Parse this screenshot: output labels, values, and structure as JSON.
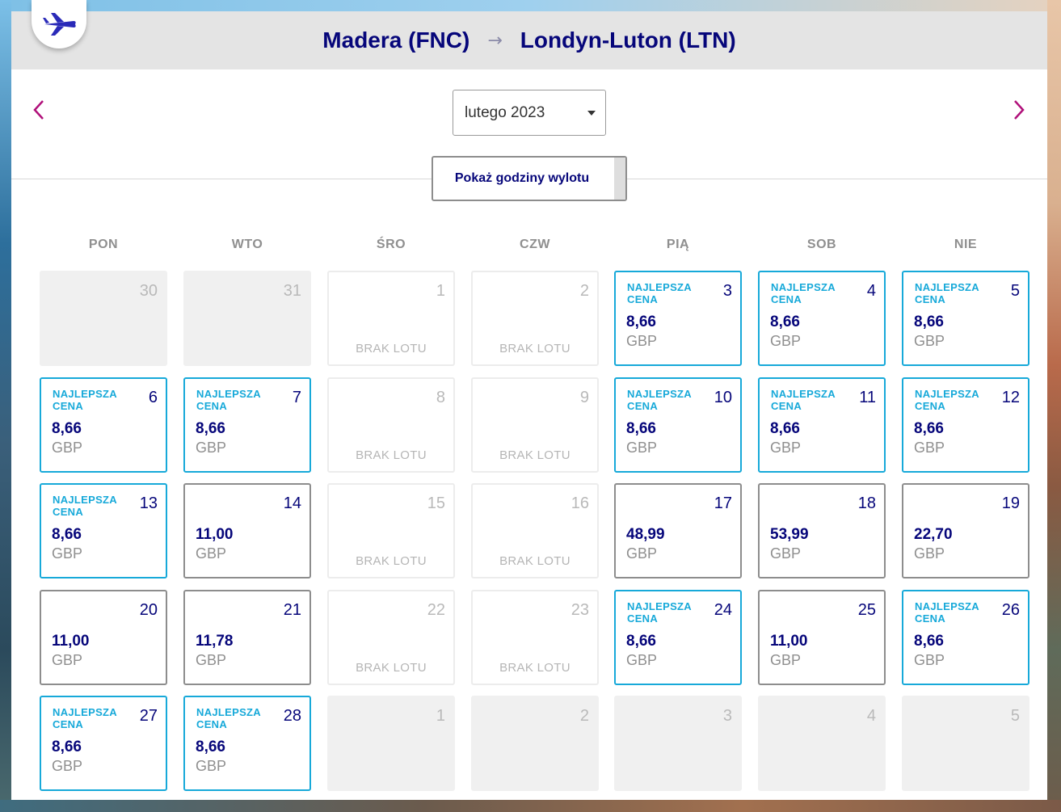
{
  "route": {
    "origin": "Madera (FNC)",
    "arrow": "→",
    "destination": "Londyn-Luton (LTN)"
  },
  "icons": {
    "plane": "airplane-icon",
    "prev": "chevron-left-icon",
    "next": "chevron-right-icon",
    "dropdown": "caret-down-icon"
  },
  "colors": {
    "brand_navy": "#06067a",
    "best_price_blue": "#17a9d9",
    "nav_magenta": "#b0107a",
    "header_gray": "#e4e4e4"
  },
  "month_selector": {
    "value": "lutego 2023"
  },
  "show_hours_button": {
    "label": "Pokaż godziny wylotu"
  },
  "weekdays": [
    "PON",
    "WTO",
    "ŚRO",
    "CZW",
    "PIĄ",
    "SOB",
    "NIE"
  ],
  "calendar": [
    [
      {
        "day": "30",
        "kind": "outside"
      },
      {
        "day": "31",
        "kind": "outside"
      },
      {
        "day": "1",
        "kind": "noflight",
        "label": "BRAK LOTU"
      },
      {
        "day": "2",
        "kind": "noflight",
        "label": "BRAK LOTU"
      },
      {
        "day": "3",
        "kind": "best",
        "badge": "NAJLEPSZA CENA",
        "price": "8,66",
        "currency": "GBP"
      },
      {
        "day": "4",
        "kind": "best",
        "badge": "NAJLEPSZA CENA",
        "price": "8,66",
        "currency": "GBP"
      },
      {
        "day": "5",
        "kind": "best",
        "badge": "NAJLEPSZA CENA",
        "price": "8,66",
        "currency": "GBP"
      }
    ],
    [
      {
        "day": "6",
        "kind": "best",
        "badge": "NAJLEPSZA CENA",
        "price": "8,66",
        "currency": "GBP"
      },
      {
        "day": "7",
        "kind": "best",
        "badge": "NAJLEPSZA CENA",
        "price": "8,66",
        "currency": "GBP"
      },
      {
        "day": "8",
        "kind": "noflight",
        "label": "BRAK LOTU"
      },
      {
        "day": "9",
        "kind": "noflight",
        "label": "BRAK LOTU"
      },
      {
        "day": "10",
        "kind": "best",
        "badge": "NAJLEPSZA CENA",
        "price": "8,66",
        "currency": "GBP"
      },
      {
        "day": "11",
        "kind": "best",
        "badge": "NAJLEPSZA CENA",
        "price": "8,66",
        "currency": "GBP"
      },
      {
        "day": "12",
        "kind": "best",
        "badge": "NAJLEPSZA CENA",
        "price": "8,66",
        "currency": "GBP"
      }
    ],
    [
      {
        "day": "13",
        "kind": "best",
        "badge": "NAJLEPSZA CENA",
        "price": "8,66",
        "currency": "GBP"
      },
      {
        "day": "14",
        "kind": "normal",
        "price": "11,00",
        "currency": "GBP"
      },
      {
        "day": "15",
        "kind": "noflight",
        "label": "BRAK LOTU"
      },
      {
        "day": "16",
        "kind": "noflight",
        "label": "BRAK LOTU"
      },
      {
        "day": "17",
        "kind": "normal",
        "price": "48,99",
        "currency": "GBP"
      },
      {
        "day": "18",
        "kind": "normal",
        "price": "53,99",
        "currency": "GBP"
      },
      {
        "day": "19",
        "kind": "normal",
        "price": "22,70",
        "currency": "GBP"
      }
    ],
    [
      {
        "day": "20",
        "kind": "normal",
        "price": "11,00",
        "currency": "GBP"
      },
      {
        "day": "21",
        "kind": "normal",
        "price": "11,78",
        "currency": "GBP"
      },
      {
        "day": "22",
        "kind": "noflight",
        "label": "BRAK LOTU"
      },
      {
        "day": "23",
        "kind": "noflight",
        "label": "BRAK LOTU"
      },
      {
        "day": "24",
        "kind": "best",
        "badge": "NAJLEPSZA CENA",
        "price": "8,66",
        "currency": "GBP"
      },
      {
        "day": "25",
        "kind": "normal",
        "price": "11,00",
        "currency": "GBP"
      },
      {
        "day": "26",
        "kind": "best",
        "badge": "NAJLEPSZA CENA",
        "price": "8,66",
        "currency": "GBP"
      }
    ],
    [
      {
        "day": "27",
        "kind": "best",
        "badge": "NAJLEPSZA CENA",
        "price": "8,66",
        "currency": "GBP"
      },
      {
        "day": "28",
        "kind": "best",
        "badge": "NAJLEPSZA CENA",
        "price": "8,66",
        "currency": "GBP"
      },
      {
        "day": "1",
        "kind": "outside"
      },
      {
        "day": "2",
        "kind": "outside"
      },
      {
        "day": "3",
        "kind": "outside"
      },
      {
        "day": "4",
        "kind": "outside"
      },
      {
        "day": "5",
        "kind": "outside"
      }
    ]
  ]
}
